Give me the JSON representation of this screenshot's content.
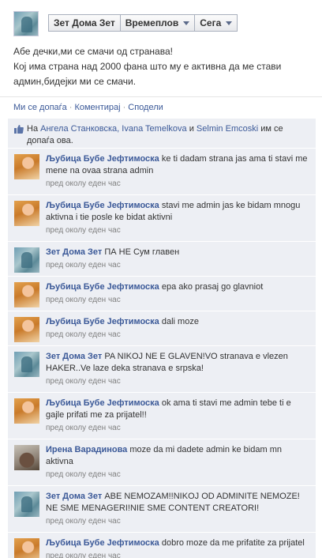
{
  "header": {
    "page_name_button": "Зет Дома Зет",
    "timeline_button": "Времеплов",
    "now_button": "Сега"
  },
  "post": {
    "lines": [
      "Абе дечки,ми се смачи од странава!",
      "Кој има страна над 2000 фана што му е активна да ме стави",
      "админ,бидејки ми се смачи."
    ]
  },
  "actions": {
    "like": "Ми се допаѓа",
    "comment": "Коментирај",
    "share": "Сподели"
  },
  "likes": {
    "prefix": "На",
    "names": [
      "Ангела Станковска,",
      "Ivana Temelkova",
      "Selmin Emcoski"
    ],
    "and": "и",
    "suffix": "им се допаѓа ова."
  },
  "comments": [
    {
      "avatar": "female",
      "author": "Љубица Бубе Јефтимоска",
      "text": "ke ti dadam strana jas ama ti stavi me mene na ovaa strana admin",
      "time": "пред околу еден час"
    },
    {
      "avatar": "female",
      "author": "Љубица Бубе Јефтимоска",
      "text": "stavi me admin jas ke bidam mnogu aktivna i tie posle ke bidat aktivni",
      "time": "пред околу еден час"
    },
    {
      "avatar": "zet",
      "author": "Зет Дома Зет",
      "text": "ПА НЕ Сум главен",
      "time": "пред околу еден час"
    },
    {
      "avatar": "female",
      "author": "Љубица Бубе Јефтимоска",
      "text": "epa ako prasaj go glavniot",
      "time": "пред околу еден час"
    },
    {
      "avatar": "female",
      "author": "Љубица Бубе Јефтимоска",
      "text": "dali moze",
      "time": "пред околу еден час"
    },
    {
      "avatar": "zet",
      "author": "Зет Дома Зет",
      "text": "PA NIKOJ NE E GLAVEN!VO stranava e vlezen HAKER..Ve laze deka stranava e srpska!",
      "time": "пред околу еден час"
    },
    {
      "avatar": "female",
      "author": "Љубица Бубе Јефтимоска",
      "text": "ok ama ti stavi me admin tebe ti e gajle prifati me za prijatel!!",
      "time": "пред околу еден час"
    },
    {
      "avatar": "irena",
      "author": "Ирена Варадинова",
      "text": "moze da mi dadete admin ke bidam mn aktivna",
      "time": "пред околу еден час"
    },
    {
      "avatar": "zet",
      "author": "Зет Дома Зет",
      "text": "ABE NEMOZAM!!NIKOJ OD ADMINITE NEMOZE! NE SME MENAGERI!NIE SME CONTENT CREATORI!",
      "time": "пред околу еден час"
    },
    {
      "avatar": "female",
      "author": "Љубица Бубе Јефтимоска",
      "text": "dobro moze da me prifatite za prijatel",
      "time": "пред околу еден час"
    }
  ]
}
